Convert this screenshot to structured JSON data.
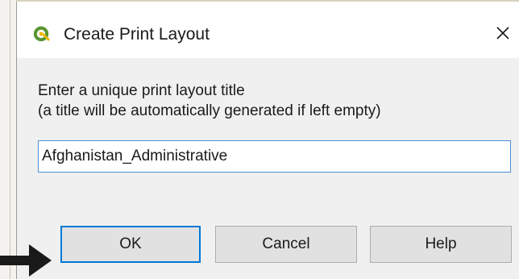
{
  "dialog": {
    "title": "Create Print Layout",
    "close_glyph": "✕",
    "icons": {
      "app": "qgis-logo-icon",
      "close": "close-icon"
    }
  },
  "prompt": {
    "line1": "Enter a unique print layout title",
    "line2": "(a title will be automatically generated if left empty)"
  },
  "input": {
    "value": "Afghanistan_Administrative"
  },
  "buttons": {
    "ok": "OK",
    "cancel": "Cancel",
    "help": "Help"
  },
  "colors": {
    "focus": "#0078d7",
    "qgis_green": "#589632",
    "qgis_yellow": "#eab800"
  }
}
